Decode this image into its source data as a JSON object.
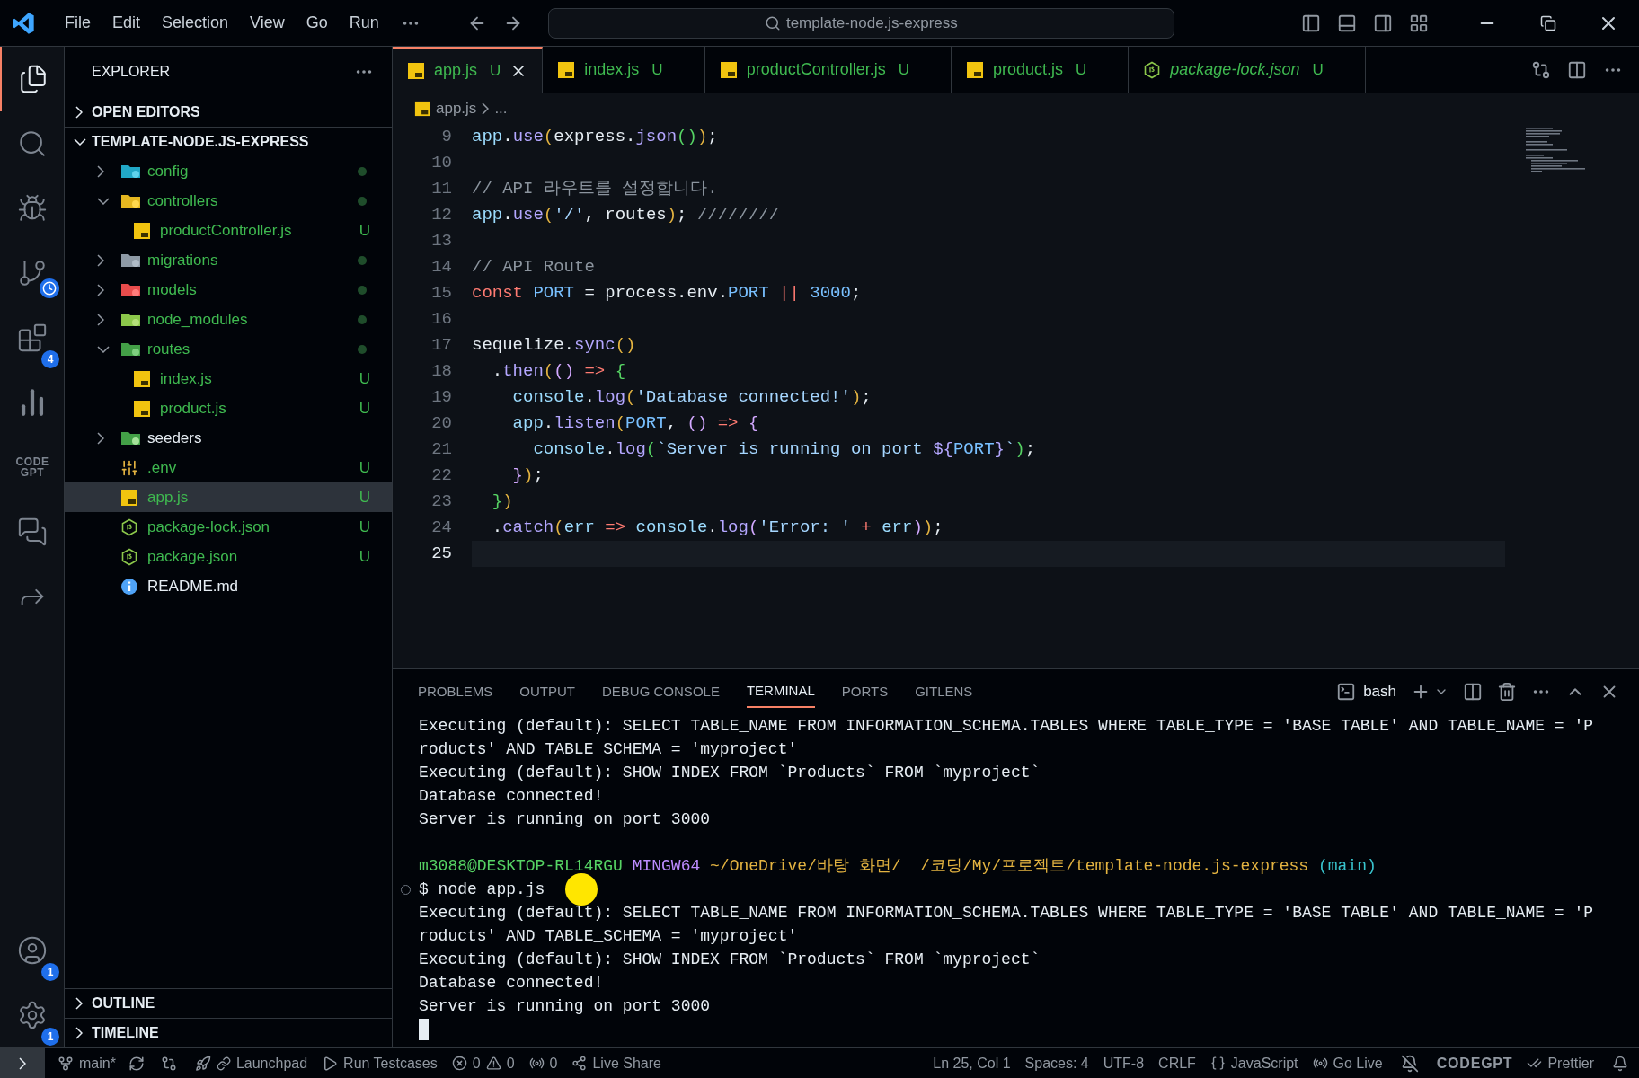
{
  "title_bar": {
    "menu": [
      "File",
      "Edit",
      "Selection",
      "View",
      "Go",
      "Run"
    ],
    "search": "template-node.js-express"
  },
  "activity_bar": {
    "items": [
      {
        "kind": "explorer",
        "selected": true
      },
      {
        "kind": "search",
        "selected": false
      },
      {
        "kind": "debug",
        "selected": false
      },
      {
        "kind": "source-control",
        "selected": false
      },
      {
        "kind": "extensions",
        "selected": false,
        "badge": "4"
      },
      {
        "kind": "charts",
        "selected": false
      },
      {
        "kind": "codegpt",
        "selected": false,
        "label": "CODE GPT"
      },
      {
        "kind": "chat",
        "selected": false
      },
      {
        "kind": "share",
        "selected": false
      }
    ],
    "bottom": [
      {
        "kind": "account",
        "badge": "1"
      },
      {
        "kind": "settings",
        "badge": "1"
      }
    ]
  },
  "sidebar": {
    "title": "EXPLORER",
    "open_editors": {
      "label": "OPEN EDITORS",
      "expanded": false
    },
    "project": {
      "label": "TEMPLATE-NODE.JS-EXPRESS",
      "expanded": true
    },
    "items": [
      {
        "name": "config",
        "kind": "config-folder",
        "expanded": false,
        "dot": true,
        "selected": false
      },
      {
        "name": "controllers",
        "kind": "gear-folder",
        "expanded": true,
        "dot": true,
        "selected": false,
        "children": [
          {
            "name": "productController.js",
            "kind": "js",
            "status": "U",
            "selected": false
          }
        ]
      },
      {
        "name": "migrations",
        "kind": "folder",
        "expanded": false,
        "dot": true,
        "selected": false
      },
      {
        "name": "models",
        "kind": "db-folder",
        "expanded": false,
        "dot": true,
        "selected": false
      },
      {
        "name": "node_modules",
        "kind": "node-folder",
        "expanded": false,
        "dot": true,
        "selected": false
      },
      {
        "name": "routes",
        "kind": "route-folder",
        "expanded": true,
        "dot": true,
        "selected": false,
        "children": [
          {
            "name": "index.js",
            "kind": "js",
            "status": "U",
            "selected": false
          },
          {
            "name": "product.js",
            "kind": "js",
            "status": "U",
            "selected": false
          }
        ]
      },
      {
        "name": "seeders",
        "kind": "leaf-folder",
        "expanded": false,
        "dot": false,
        "selected": false
      },
      {
        "name": ".env",
        "kind": "env",
        "status": "U",
        "selected": false
      },
      {
        "name": "app.js",
        "kind": "js",
        "status": "U",
        "selected": true
      },
      {
        "name": "package-lock.json",
        "kind": "node",
        "status": "U",
        "selected": false
      },
      {
        "name": "package.json",
        "kind": "node",
        "status": "U",
        "selected": false
      },
      {
        "name": "README.md",
        "kind": "info",
        "selected": false
      }
    ],
    "sections": [
      {
        "label": "OUTLINE",
        "expanded": false
      },
      {
        "label": "TIMELINE",
        "expanded": false
      }
    ]
  },
  "tabs": [
    {
      "label": "app.js",
      "kind": "js",
      "status": "U",
      "selected": true,
      "preview": false
    },
    {
      "label": "index.js",
      "kind": "js",
      "status": "U",
      "selected": false,
      "preview": false
    },
    {
      "label": "productController.js",
      "kind": "js",
      "status": "U",
      "selected": false,
      "preview": false
    },
    {
      "label": "product.js",
      "kind": "js",
      "status": "U",
      "selected": false,
      "preview": false
    },
    {
      "label": "package-lock.json",
      "kind": "node",
      "status": "U",
      "selected": false,
      "preview": true
    }
  ],
  "breadcrumb": [
    "app.js",
    "..."
  ],
  "code": [
    {
      "number": "9",
      "current": false,
      "tokens": [
        {
          "text": "app",
          "kind": "ident"
        },
        {
          "text": ".",
          "kind": "plain"
        },
        {
          "text": "use",
          "kind": "method"
        },
        {
          "text": "(",
          "kind": "b1"
        },
        {
          "text": "express.",
          "kind": "plain"
        },
        {
          "text": "json",
          "kind": "method"
        },
        {
          "text": "()",
          "kind": "b3"
        },
        {
          "text": ")",
          "kind": "b1"
        },
        {
          "text": ";",
          "kind": "plain"
        }
      ]
    },
    {
      "number": "10",
      "current": false
    },
    {
      "number": "11",
      "current": false,
      "tokens": [
        {
          "text": "// API 라우트를 설정합니다.",
          "kind": "comment"
        }
      ]
    },
    {
      "number": "12",
      "current": false,
      "tokens": [
        {
          "text": "app",
          "kind": "ident"
        },
        {
          "text": ".",
          "kind": "plain"
        },
        {
          "text": "use",
          "kind": "method"
        },
        {
          "text": "(",
          "kind": "b1"
        },
        {
          "text": "'/'",
          "kind": "string"
        },
        {
          "text": ", routes",
          "kind": "plain"
        },
        {
          "text": ")",
          "kind": "b1"
        },
        {
          "text": ";",
          "kind": "plain"
        },
        {
          "text": " ////////",
          "kind": "comment"
        }
      ]
    },
    {
      "number": "13",
      "current": false
    },
    {
      "number": "14",
      "current": false,
      "tokens": [
        {
          "text": "// API Route",
          "kind": "comment"
        }
      ]
    },
    {
      "number": "15",
      "current": false,
      "tokens": [
        {
          "text": "const",
          "kind": "keyword"
        },
        {
          "text": " PORT",
          "kind": "const"
        },
        {
          "text": " = process.env.",
          "kind": "plain"
        },
        {
          "text": "PORT",
          "kind": "const"
        },
        {
          "text": " ||",
          "kind": "keyword"
        },
        {
          "text": " 3000",
          "kind": "const"
        },
        {
          "text": ";",
          "kind": "plain"
        }
      ]
    },
    {
      "number": "16",
      "current": false
    },
    {
      "number": "17",
      "current": false,
      "tokens": [
        {
          "text": "sequelize.",
          "kind": "plain"
        },
        {
          "text": "sync",
          "kind": "method"
        },
        {
          "text": "()",
          "kind": "b1"
        }
      ]
    },
    {
      "number": "18",
      "current": false,
      "tokens": [
        {
          "text": "  .",
          "kind": "plain"
        },
        {
          "text": "then",
          "kind": "method"
        },
        {
          "text": "(",
          "kind": "b1"
        },
        {
          "text": "()",
          "kind": "b2"
        },
        {
          "text": " =>",
          "kind": "keyword"
        },
        {
          "text": " {",
          "kind": "b3"
        }
      ]
    },
    {
      "number": "19",
      "current": false,
      "tokens": [
        {
          "text": "    console",
          "kind": "ident"
        },
        {
          "text": ".",
          "kind": "plain"
        },
        {
          "text": "log",
          "kind": "method"
        },
        {
          "text": "(",
          "kind": "b1"
        },
        {
          "text": "'Database connected!'",
          "kind": "string"
        },
        {
          "text": ")",
          "kind": "b1"
        },
        {
          "text": ";",
          "kind": "plain"
        }
      ]
    },
    {
      "number": "20",
      "current": false,
      "tokens": [
        {
          "text": "    app",
          "kind": "ident"
        },
        {
          "text": ".",
          "kind": "plain"
        },
        {
          "text": "listen",
          "kind": "method"
        },
        {
          "text": "(",
          "kind": "b1"
        },
        {
          "text": "PORT",
          "kind": "const"
        },
        {
          "text": ", ",
          "kind": "plain"
        },
        {
          "text": "()",
          "kind": "b2"
        },
        {
          "text": " =>",
          "kind": "keyword"
        },
        {
          "text": " {",
          "kind": "b2"
        }
      ]
    },
    {
      "number": "21",
      "current": false,
      "tokens": [
        {
          "text": "      console",
          "kind": "ident"
        },
        {
          "text": ".",
          "kind": "plain"
        },
        {
          "text": "log",
          "kind": "method"
        },
        {
          "text": "(",
          "kind": "b3"
        },
        {
          "text": "`Server is running on port ",
          "kind": "string"
        },
        {
          "text": "${",
          "kind": "method"
        },
        {
          "text": "PORT",
          "kind": "const"
        },
        {
          "text": "}",
          "kind": "method"
        },
        {
          "text": "`",
          "kind": "string"
        },
        {
          "text": ")",
          "kind": "b3"
        },
        {
          "text": ";",
          "kind": "plain"
        }
      ]
    },
    {
      "number": "22",
      "current": false,
      "tokens": [
        {
          "text": "    }",
          "kind": "b2"
        },
        {
          "text": ")",
          "kind": "b1"
        },
        {
          "text": ";",
          "kind": "plain"
        }
      ]
    },
    {
      "number": "23",
      "current": false,
      "tokens": [
        {
          "text": "  }",
          "kind": "b3"
        },
        {
          "text": ")",
          "kind": "b1"
        }
      ]
    },
    {
      "number": "24",
      "current": false,
      "tokens": [
        {
          "text": "  .",
          "kind": "plain"
        },
        {
          "text": "catch",
          "kind": "method"
        },
        {
          "text": "(",
          "kind": "b1"
        },
        {
          "text": "err",
          "kind": "ident"
        },
        {
          "text": " =>",
          "kind": "keyword"
        },
        {
          "text": " console",
          "kind": "ident"
        },
        {
          "text": ".",
          "kind": "plain"
        },
        {
          "text": "log",
          "kind": "method"
        },
        {
          "text": "(",
          "kind": "b2"
        },
        {
          "text": "'Error: '",
          "kind": "string"
        },
        {
          "text": " +",
          "kind": "keyword"
        },
        {
          "text": " err",
          "kind": "ident"
        },
        {
          "text": ")",
          "kind": "b2"
        },
        {
          "text": ")",
          "kind": "b1"
        },
        {
          "text": ";",
          "kind": "plain"
        }
      ]
    },
    {
      "number": "25",
      "current": true
    }
  ],
  "panel": {
    "tabs": [
      {
        "label": "PROBLEMS",
        "selected": false
      },
      {
        "label": "OUTPUT",
        "selected": false
      },
      {
        "label": "DEBUG CONSOLE",
        "selected": false
      },
      {
        "label": "TERMINAL",
        "selected": true
      },
      {
        "label": "PORTS",
        "selected": false
      },
      {
        "label": "GITLENS",
        "selected": false
      }
    ],
    "shell": "bash",
    "terminal": [
      {
        "command": false,
        "segments": [
          {
            "text": "Executing (default): SELECT TABLE_NAME FROM INFORMATION_SCHEMA.TABLES WHERE TABLE_TYPE = 'BASE TABLE' AND TABLE_NAME = 'P",
            "kind": "plain"
          }
        ]
      },
      {
        "command": false,
        "segments": [
          {
            "text": "roducts' AND TABLE_SCHEMA = 'myproject'",
            "kind": "plain"
          }
        ]
      },
      {
        "command": false,
        "segments": [
          {
            "text": "Executing (default): SHOW INDEX FROM `Products` FROM `myproject`",
            "kind": "plain"
          }
        ]
      },
      {
        "command": false,
        "segments": [
          {
            "text": "Database connected!",
            "kind": "plain"
          }
        ]
      },
      {
        "command": false,
        "segments": [
          {
            "text": "Server is running on port 3000",
            "kind": "plain"
          }
        ]
      },
      {
        "command": false
      },
      {
        "command": false,
        "segments": [
          {
            "text": "m3088@DESKTOP-RL14RGU",
            "kind": "user"
          },
          {
            "text": " MINGW64",
            "kind": "host"
          },
          {
            "text": " ~/OneDrive/바탕 화면/  /코딩/My/프로젝트/template-node.js-express",
            "kind": "path"
          },
          {
            "text": " (main)",
            "kind": "branch"
          }
        ]
      },
      {
        "command": true,
        "segments": [
          {
            "text": "$ node app.js",
            "kind": "plain"
          }
        ]
      },
      {
        "command": false,
        "segments": [
          {
            "text": "Executing (default): SELECT TABLE_NAME FROM INFORMATION_SCHEMA.TABLES WHERE TABLE_TYPE = 'BASE TABLE' AND TABLE_NAME = 'P",
            "kind": "plain"
          }
        ]
      },
      {
        "command": false,
        "segments": [
          {
            "text": "roducts' AND TABLE_SCHEMA = 'myproject'",
            "kind": "plain"
          }
        ]
      },
      {
        "command": false,
        "segments": [
          {
            "text": "Executing (default): SHOW INDEX FROM `Products` FROM `myproject`",
            "kind": "plain"
          }
        ]
      },
      {
        "command": false,
        "segments": [
          {
            "text": "Database connected!",
            "kind": "plain"
          }
        ]
      },
      {
        "command": false,
        "segments": [
          {
            "text": "Server is running on port 3000",
            "kind": "plain"
          }
        ]
      }
    ]
  },
  "status_bar": {
    "branch": "main*",
    "launchpad": "Launchpad",
    "run": "Run Testcases",
    "errors": "0",
    "warnings": "0",
    "ports": "0",
    "live_share": "Live Share",
    "position": "Ln 25, Col 1",
    "spaces": "Spaces: 4",
    "encoding": "UTF-8",
    "eol": "CRLF",
    "language": "JavaScript",
    "go_live": "Go Live",
    "codegpt": "CODEGPT",
    "prettier": "Prettier"
  }
}
